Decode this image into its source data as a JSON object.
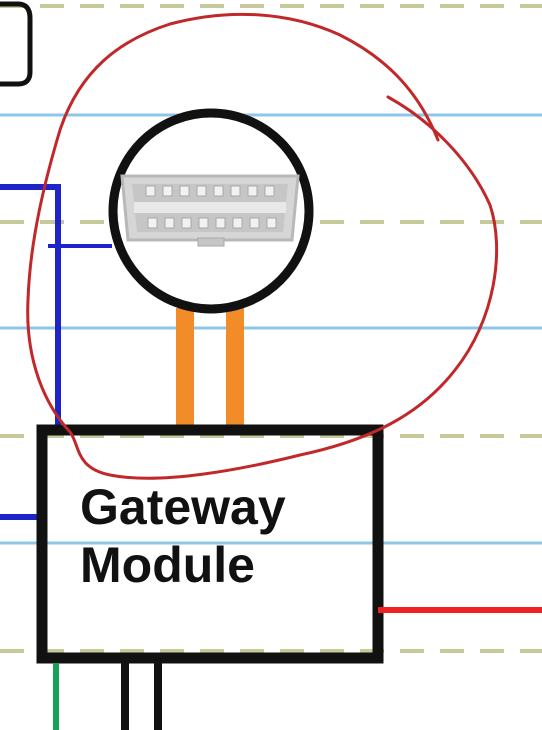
{
  "gateway_module": {
    "line1": "Gateway",
    "line2": "Module"
  },
  "colors": {
    "paper_blue_line": "#8ec6e8",
    "paper_dashed_line": "#c8c99a",
    "module_border": "#111111",
    "obd_circle": "#111111",
    "annotation_circle": "#c0282a",
    "wire_orange": "#f28c28",
    "wire_blue": "#1f24c8",
    "wire_red": "#ee2222",
    "wire_green": "#17a05a",
    "wire_black": "#111111"
  },
  "icons": {
    "obd_port": "obd2-connector-icon"
  }
}
